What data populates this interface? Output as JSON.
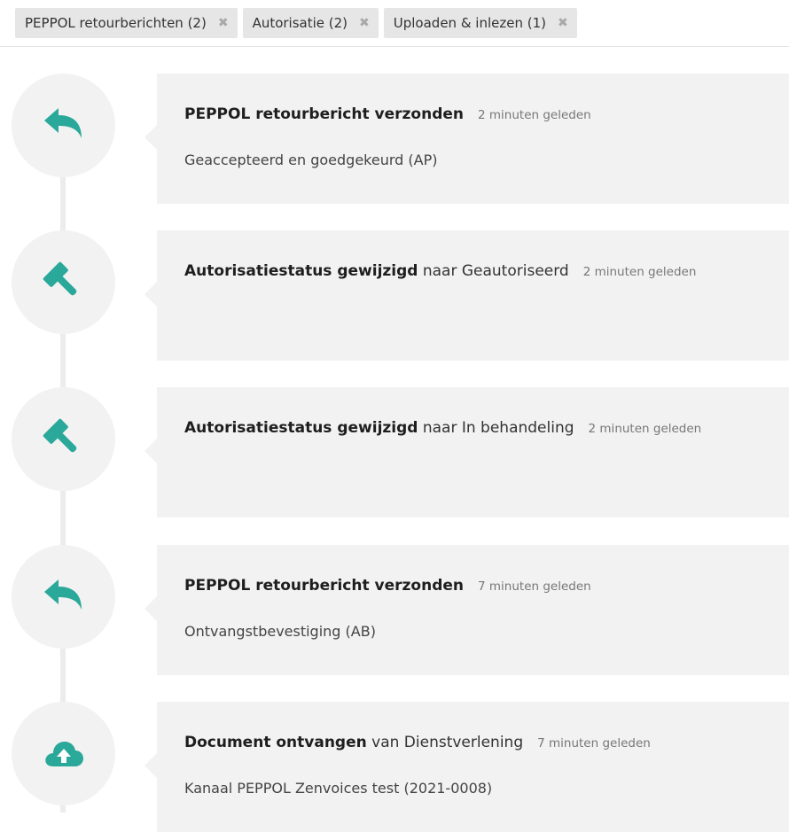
{
  "filters": [
    {
      "label": "PEPPOL retourberichten (2)",
      "remove": "✖"
    },
    {
      "label": "Autorisatie (2)",
      "remove": "✖"
    },
    {
      "label": "Uploaden & inlezen (1)",
      "remove": "✖"
    }
  ],
  "accent_color": "#2aa89a",
  "events": [
    {
      "icon": "reply-arrow-icon",
      "title": "PEPPOL retourbericht verzonden",
      "rest": "",
      "time": "2 minuten geleden",
      "detail": "Geaccepteerd en goedgekeurd (AP)"
    },
    {
      "icon": "gavel-icon",
      "title": "Autorisatiestatus gewijzigd",
      "rest": " naar Geautoriseerd",
      "time": "2 minuten geleden",
      "detail": ""
    },
    {
      "icon": "gavel-icon",
      "title": "Autorisatiestatus gewijzigd",
      "rest": " naar In behandeling",
      "time": "2 minuten geleden",
      "detail": ""
    },
    {
      "icon": "reply-arrow-icon",
      "title": "PEPPOL retourbericht verzonden",
      "rest": "",
      "time": "7 minuten geleden",
      "detail": "Ontvangstbevestiging (AB)"
    },
    {
      "icon": "cloud-upload-icon",
      "title": "Document ontvangen",
      "rest": " van Dienstverlening",
      "time": "7 minuten geleden",
      "detail": "Kanaal PEPPOL Zenvoices test (2021-0008)"
    }
  ]
}
